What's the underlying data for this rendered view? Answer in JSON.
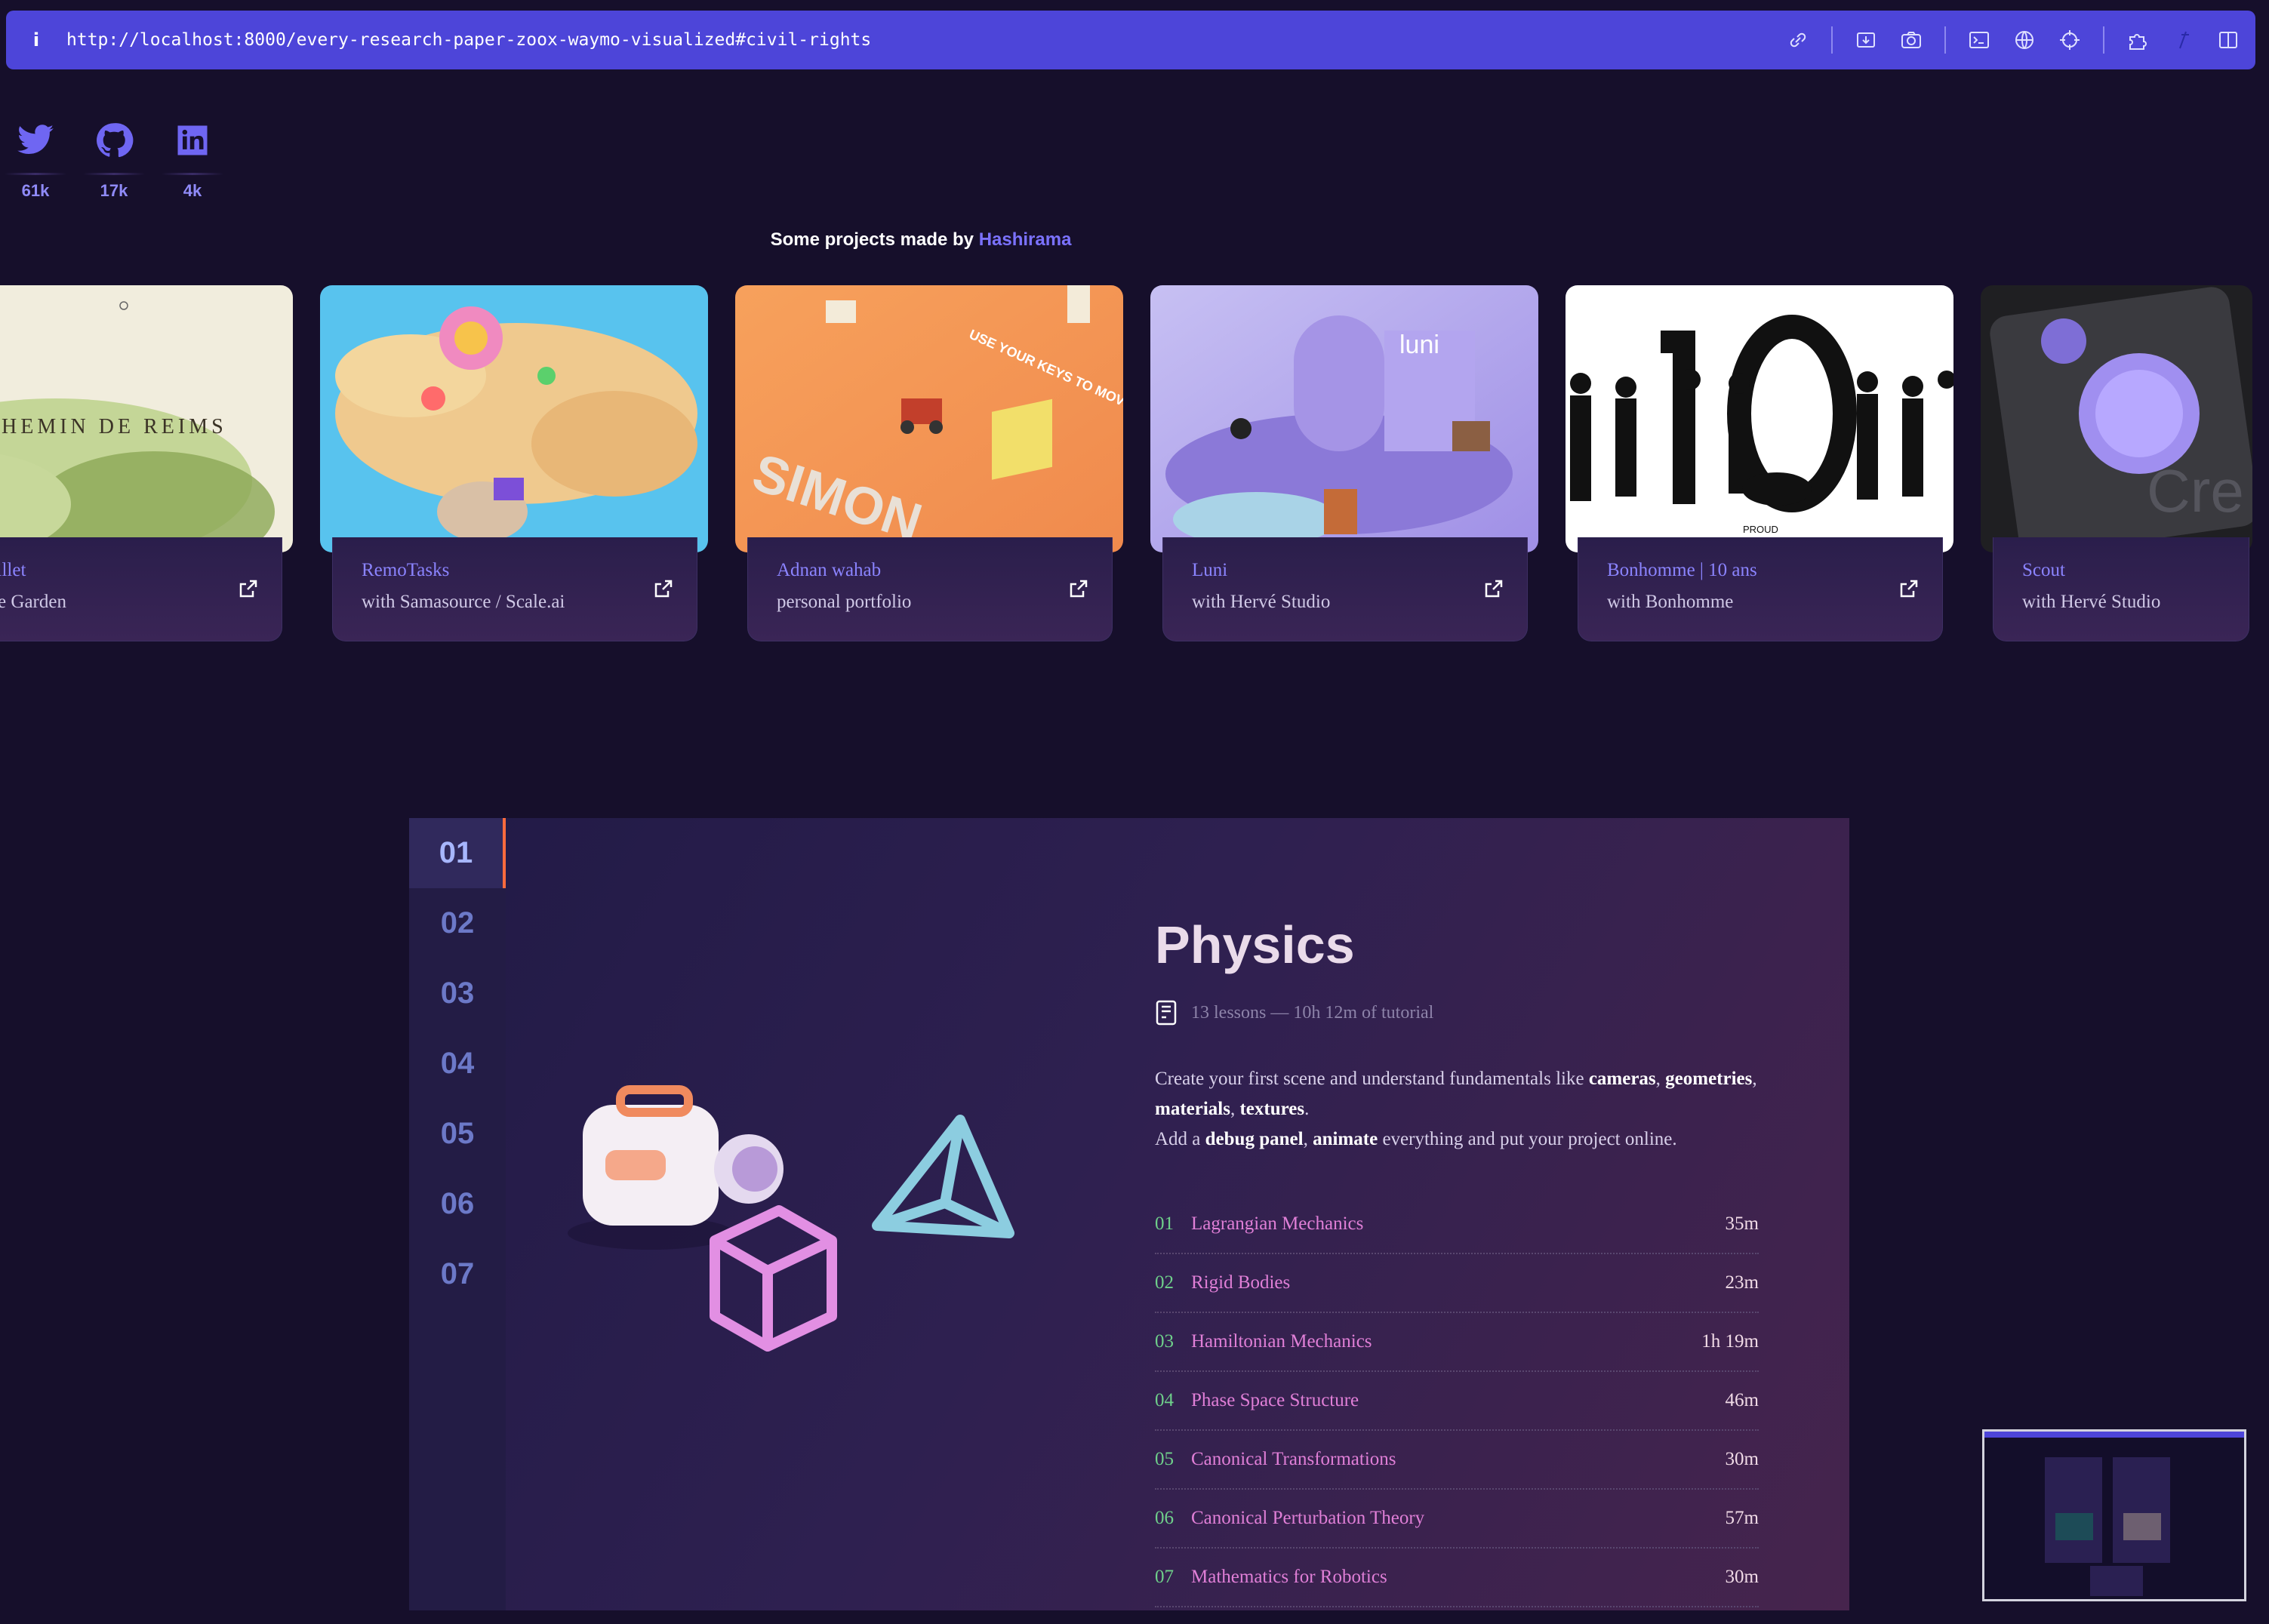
{
  "browser": {
    "url": "http://localhost:8000/every-research-paper-zoox-waymo-visualized#civil-rights",
    "info_icon": "i",
    "tools": [
      "link-icon",
      "download-icon",
      "camera-icon",
      "terminal-icon",
      "globe-icon",
      "crosshair-icon",
      "puzzle-icon",
      "extension-icon",
      "sidebar-icon"
    ]
  },
  "socials": [
    {
      "name": "twitter-icon",
      "count": "61k"
    },
    {
      "name": "github-icon",
      "count": "17k"
    },
    {
      "name": "linkedin-icon",
      "count": "4k"
    }
  ],
  "projects": {
    "heading_prefix": "Some projects made by",
    "heading_brand": "Hashirama",
    "cards": [
      {
        "title": "gne Taillet",
        "subtitle": "mersive Garden",
        "image_text": "HEMIN DE REIMS"
      },
      {
        "title": "RemoTasks",
        "subtitle": "with Samasource / Scale.ai"
      },
      {
        "title": "Adnan wahab",
        "subtitle": "personal portfolio",
        "image_text": "USE YOUR KEYS TO MOVE AROUND"
      },
      {
        "title": "Luni",
        "subtitle": "with Hervé Studio",
        "image_text": "luni"
      },
      {
        "title": "Bonhomme | 10 ans",
        "subtitle": "with Bonhomme",
        "image_text": "PROUD"
      },
      {
        "title": "Scout",
        "subtitle": "with Hervé Studio"
      }
    ]
  },
  "course": {
    "chapters": [
      "01",
      "02",
      "03",
      "04",
      "05",
      "06",
      "07"
    ],
    "active_chapter": "01",
    "title": "Physics",
    "meta": "13 lessons — 10h 12m of tutorial",
    "desc": {
      "p1": "Create your first scene and understand fundamentals like",
      "b1": "cameras",
      "b2": "geometries",
      "b3": "materials",
      "b4": "textures",
      "p2": "Add a",
      "b5": "debug panel",
      "b6": "animate",
      "p3": "everything and put your project online."
    },
    "lessons": [
      {
        "num": "01",
        "title": "Lagrangian Mechanics",
        "duration": "35m"
      },
      {
        "num": "02",
        "title": "Rigid Bodies",
        "duration": "23m"
      },
      {
        "num": "03",
        "title": "Hamiltonian Mechanics",
        "duration": "1h 19m"
      },
      {
        "num": "04",
        "title": "Phase Space Structure",
        "duration": "46m"
      },
      {
        "num": "05",
        "title": "Canonical Transformations",
        "duration": "30m"
      },
      {
        "num": "06",
        "title": "Canonical Perturbation Theory",
        "duration": "57m"
      },
      {
        "num": "07",
        "title": "Mathematics for Robotics",
        "duration": "30m"
      }
    ]
  },
  "colors": {
    "accent": "#4d45d9",
    "brand": "#7b72ff",
    "lesson_num": "#6fd08b",
    "lesson_title": "#e07fd7"
  }
}
